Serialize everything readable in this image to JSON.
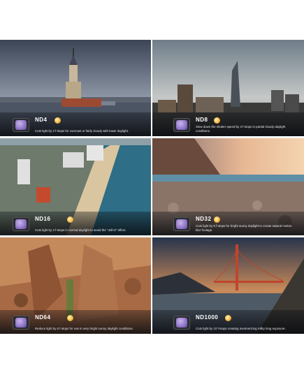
{
  "tiles": [
    {
      "name": "ND4",
      "description": "Cuts light by 2 f-stops for overcast or fairly cloudy with lower daylight."
    },
    {
      "name": "ND8",
      "description": "Slow down the shutter speed by 3 f-stops in partial cloudy daylight conditions."
    },
    {
      "name": "ND16",
      "description": "Cuts light by 4 f-stops in normal daylight to avoid the “Jell-O” effect."
    },
    {
      "name": "ND32",
      "description": "Cuts light by 5 f-stops for bright sunny daylight to create natural motion blur footage."
    },
    {
      "name": "ND64",
      "description": "Reduce light by 6 f-stops for use in very bright sunny daylight conditions."
    },
    {
      "name": "ND1000",
      "description": "Cuts light by 10 f-stops creating mesmerizing milky long exposure."
    }
  ],
  "icon": "sun-icon",
  "colors": {
    "caption_bg": "#0b0d12",
    "filter_glass": "#9b82d2",
    "sun": "#f6b73c"
  }
}
